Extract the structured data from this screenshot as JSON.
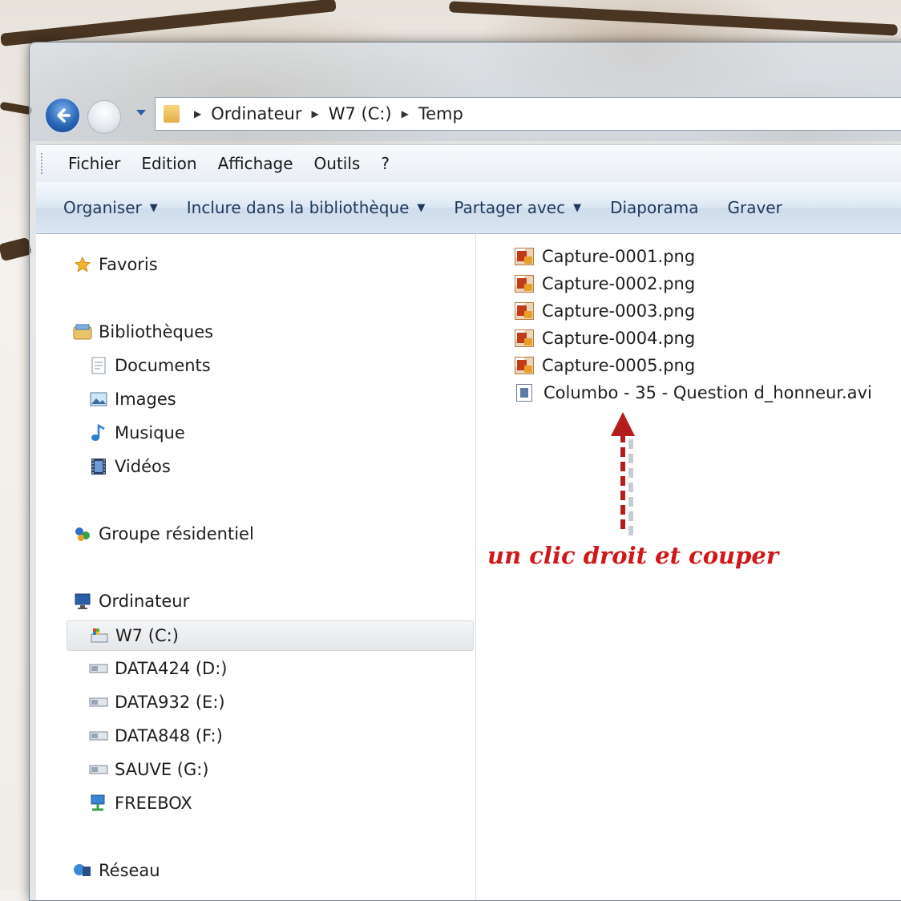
{
  "window": {
    "breadcrumb": [
      "Ordinateur",
      "W7 (C:)",
      "Temp"
    ],
    "nav_buttons": {
      "back_icon": "back-arrow-icon",
      "forward_icon": "forward-arrow-icon",
      "history_icon": "chevron-down-icon"
    }
  },
  "menubar": {
    "items": [
      "Fichier",
      "Edition",
      "Affichage",
      "Outils",
      "?"
    ]
  },
  "commandbar": {
    "items": [
      {
        "label": "Organiser",
        "dropdown": true
      },
      {
        "label": "Inclure dans la bibliothèque",
        "dropdown": true
      },
      {
        "label": "Partager avec",
        "dropdown": true
      },
      {
        "label": "Diaporama",
        "dropdown": false
      },
      {
        "label": "Graver",
        "dropdown": false
      }
    ]
  },
  "navpane": {
    "favorites": {
      "label": "Favoris",
      "icon": "star-icon"
    },
    "libraries": {
      "label": "Bibliothèques",
      "icon": "library-icon",
      "children": [
        {
          "label": "Documents",
          "icon": "documents-icon"
        },
        {
          "label": "Images",
          "icon": "images-icon"
        },
        {
          "label": "Musique",
          "icon": "music-icon"
        },
        {
          "label": "Vidéos",
          "icon": "videos-icon"
        }
      ]
    },
    "homegroup": {
      "label": "Groupe résidentiel",
      "icon": "homegroup-icon"
    },
    "computer": {
      "label": "Ordinateur",
      "icon": "computer-icon",
      "children": [
        {
          "label": "W7 (C:)",
          "icon": "system-drive-icon",
          "selected": true
        },
        {
          "label": "DATA424 (D:)",
          "icon": "drive-icon"
        },
        {
          "label": "DATA932 (E:)",
          "icon": "drive-icon"
        },
        {
          "label": "DATA848 (F:)",
          "icon": "drive-icon"
        },
        {
          "label": "SAUVE (G:)",
          "icon": "drive-icon"
        },
        {
          "label": "FREEBOX",
          "icon": "network-drive-icon"
        }
      ]
    },
    "network": {
      "label": "Réseau",
      "icon": "network-icon"
    }
  },
  "files": [
    {
      "name": "Capture-0001.png",
      "icon": "png-file-icon"
    },
    {
      "name": "Capture-0002.png",
      "icon": "png-file-icon"
    },
    {
      "name": "Capture-0003.png",
      "icon": "png-file-icon"
    },
    {
      "name": "Capture-0004.png",
      "icon": "png-file-icon"
    },
    {
      "name": "Capture-0005.png",
      "icon": "png-file-icon"
    },
    {
      "name": "Columbo - 35 - Question d_honneur.avi",
      "icon": "video-file-icon"
    }
  ],
  "annotation": {
    "text": "un clic droit et couper",
    "color": "#d01818"
  },
  "colors": {
    "accent": "#2a66b8",
    "cmdbar_text": "#1e395b"
  }
}
